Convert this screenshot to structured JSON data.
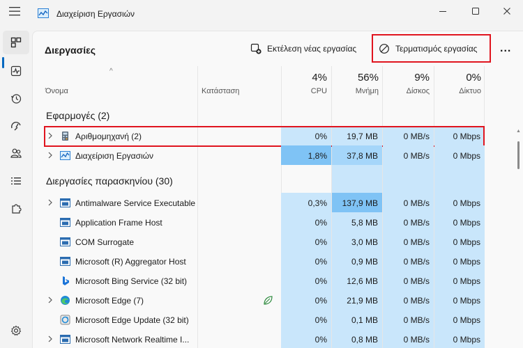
{
  "window": {
    "title": "Διαχείριση Εργασιών"
  },
  "toolbar": {
    "page_title": "Διεργασίες",
    "run_new_task": "Εκτέλεση νέας εργασίας",
    "end_task": "Τερματισμός εργασίας",
    "more": "..."
  },
  "columns": {
    "name": "Όνομα",
    "status": "Κατάσταση",
    "cpu_pct": "4%",
    "cpu": "CPU",
    "memory_pct": "56%",
    "memory": "Μνήμη",
    "disk_pct": "9%",
    "disk": "Δίσκος",
    "network_pct": "0%",
    "network": "Δίκτυο"
  },
  "groups": {
    "apps": "Εφαρμογές (2)",
    "background": "Διεργασίες παρασκηνίου (30)"
  },
  "apps": [
    {
      "name": "Αριθμομηχανή (2)",
      "cpu": "0%",
      "memory": "19,7 MB",
      "disk": "0 MB/s",
      "network": "0 Mbps",
      "icon": "calculator-icon"
    },
    {
      "name": "Διαχείριση Εργασιών",
      "cpu": "1,8%",
      "memory": "37,8 MB",
      "disk": "0 MB/s",
      "network": "0 Mbps",
      "icon": "task-manager-icon"
    }
  ],
  "background": [
    {
      "name": "Antimalware Service Executable",
      "cpu": "0,3%",
      "memory": "137,9 MB",
      "disk": "0 MB/s",
      "network": "0 Mbps",
      "icon": "app-window-icon"
    },
    {
      "name": "Application Frame Host",
      "cpu": "0%",
      "memory": "5,8 MB",
      "disk": "0 MB/s",
      "network": "0 Mbps",
      "icon": "app-window-icon"
    },
    {
      "name": "COM Surrogate",
      "cpu": "0%",
      "memory": "3,0 MB",
      "disk": "0 MB/s",
      "network": "0 Mbps",
      "icon": "app-window-icon"
    },
    {
      "name": "Microsoft (R) Aggregator Host",
      "cpu": "0%",
      "memory": "0,9 MB",
      "disk": "0 MB/s",
      "network": "0 Mbps",
      "icon": "app-window-icon"
    },
    {
      "name": "Microsoft Bing Service (32 bit)",
      "cpu": "0%",
      "memory": "12,6 MB",
      "disk": "0 MB/s",
      "network": "0 Mbps",
      "icon": "bing-icon"
    },
    {
      "name": "Microsoft Edge (7)",
      "cpu": "0%",
      "memory": "21,9 MB",
      "disk": "0 MB/s",
      "network": "0 Mbps",
      "icon": "edge-icon"
    },
    {
      "name": "Microsoft Edge Update (32 bit)",
      "cpu": "0%",
      "memory": "0,1 MB",
      "disk": "0 MB/s",
      "network": "0 Mbps",
      "icon": "edge-update-icon"
    },
    {
      "name": "Microsoft Network Realtime I...",
      "cpu": "0%",
      "memory": "0,8 MB",
      "disk": "0 MB/s",
      "network": "0 Mbps",
      "icon": "app-window-icon"
    }
  ],
  "colors": {
    "accent": "#0067c0",
    "highlight_box": "#e0141e",
    "heat_light": "#c9e6fb",
    "heat_mid": "#a5d6fa",
    "heat_strong": "#7fc3f5"
  }
}
